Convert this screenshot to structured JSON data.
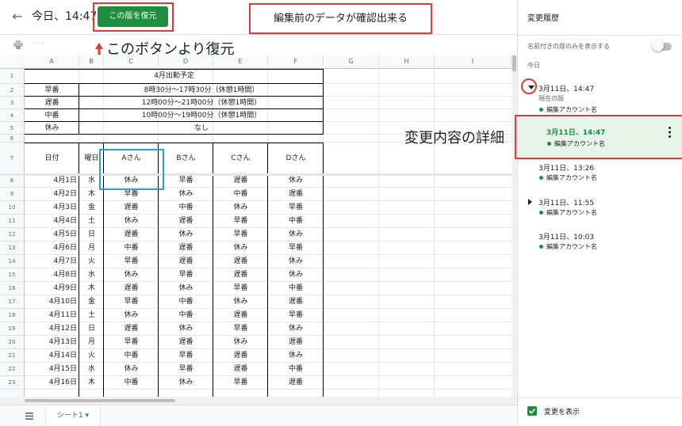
{
  "header": {
    "back_icon": "back-arrow-icon",
    "version_title": "今日、14:47",
    "restore_button_label": "この版を復元",
    "note": "編集前のデータが確認出来る"
  },
  "annotations": {
    "restore_hint": "このボタンより復元",
    "detail_hint": "変更内容の詳細"
  },
  "toolbar": {
    "print_icon": "print-icon",
    "more_label": "···"
  },
  "sheet": {
    "columns": [
      "A",
      "B",
      "C",
      "D",
      "E",
      "F",
      "G",
      "H",
      "I"
    ],
    "rows": [
      "1",
      "2",
      "3",
      "4",
      "5",
      "6",
      "7",
      "8",
      "9",
      "10",
      "11",
      "12",
      "13",
      "14",
      "15",
      "16",
      "17",
      "18",
      "19",
      "20",
      "21",
      "22",
      "23"
    ],
    "title": "4月出勤予定",
    "shifts": [
      {
        "name": "早番",
        "time": "8時30分～17時30分（休憩1時間）"
      },
      {
        "name": "遅番",
        "time": "12時00分～21時00分（休憩1時間）"
      },
      {
        "name": "中番",
        "time": "10時00分～19時00分（休憩1時間）"
      },
      {
        "name": "休み",
        "time": "なし"
      }
    ],
    "headers": [
      "日付",
      "曜日",
      "Aさん",
      "Bさん",
      "Cさん",
      "Dさん"
    ],
    "days": [
      [
        "4月1日",
        "水",
        "休み",
        "早番",
        "遅番",
        "休み"
      ],
      [
        "4月2日",
        "木",
        "早番",
        "休み",
        "中番",
        "遅番"
      ],
      [
        "4月3日",
        "金",
        "遅番",
        "中番",
        "休み",
        "早番"
      ],
      [
        "4月4日",
        "土",
        "休み",
        "遅番",
        "早番",
        "中番"
      ],
      [
        "4月5日",
        "日",
        "遅番",
        "休み",
        "早番",
        "休み"
      ],
      [
        "4月6日",
        "月",
        "中番",
        "遅番",
        "休み",
        "早番"
      ],
      [
        "4月7日",
        "火",
        "早番",
        "遅番",
        "遅番",
        "休み"
      ],
      [
        "4月8日",
        "水",
        "休み",
        "早番",
        "遅番",
        "休み"
      ],
      [
        "4月9日",
        "木",
        "遅番",
        "休み",
        "早番",
        "中番"
      ],
      [
        "4月10日",
        "金",
        "早番",
        "中番",
        "休み",
        "遅番"
      ],
      [
        "4月11日",
        "土",
        "休み",
        "中番",
        "遅番",
        "早番"
      ],
      [
        "4月12日",
        "日",
        "遅番",
        "休み",
        "早番",
        "休み"
      ],
      [
        "4月13日",
        "月",
        "早番",
        "遅番",
        "休み",
        "遅番"
      ],
      [
        "4月14日",
        "火",
        "中番",
        "早番",
        "遅番",
        "休み"
      ],
      [
        "4月15日",
        "水",
        "休み",
        "早番",
        "遅番",
        "中番"
      ],
      [
        "4月16日",
        "木",
        "中番",
        "休み",
        "早番",
        "遅番"
      ]
    ],
    "tab_label": "シート1 ▾",
    "sheets_menu_icon": "sheets-list-icon"
  },
  "panel": {
    "title": "変更履歴",
    "named_only_label": "名前付きの版のみを表示する",
    "today_label": "今日",
    "versions": [
      {
        "time": "3月11日、14:47",
        "sub": "現在の版",
        "author": "編集アカウント名"
      },
      {
        "time": "3月11日、14:47",
        "author": "編集アカウント名"
      },
      {
        "time": "3月11日、13:26",
        "author": "編集アカウント名"
      },
      {
        "time": "3月11日、11:55",
        "author": "編集アカウント名"
      },
      {
        "time": "3月11日、10:03",
        "author": "編集アカウント名"
      }
    ],
    "show_changes_label": "変更を表示"
  },
  "colors": {
    "accent": "#1e8e3e",
    "highlight": "#e53935",
    "selection": "#29a0d8",
    "selected_row": "#e6f4ea"
  }
}
